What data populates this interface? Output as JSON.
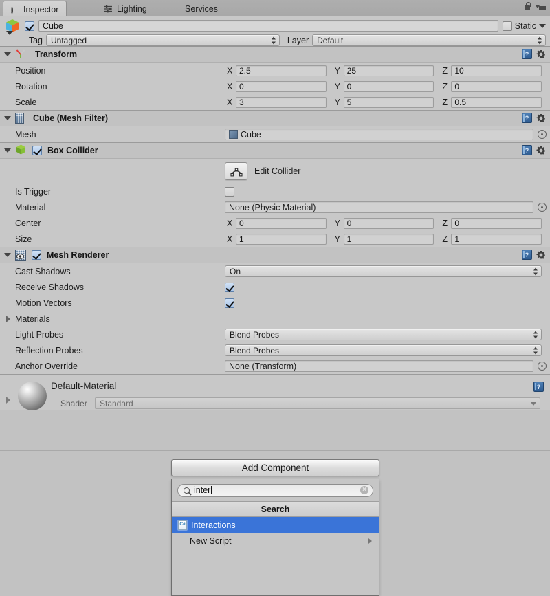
{
  "window": {
    "tabs": [
      {
        "label": "Inspector",
        "icon": "info-icon",
        "active": true
      },
      {
        "label": "Lighting",
        "icon": "lighting-sliders-icon",
        "active": false
      },
      {
        "label": "Services",
        "icon": "none",
        "active": false
      }
    ],
    "lock_icon": "lock-icon",
    "menu_icon": "hamburger-menu-icon"
  },
  "object_header": {
    "icon": "gameobject-cube-icon",
    "enabled": true,
    "name": "Cube",
    "static_label": "Static",
    "static_checked": false,
    "tag_label": "Tag",
    "tag_value": "Untagged",
    "layer_label": "Layer",
    "layer_value": "Default"
  },
  "components": [
    {
      "id": "transform",
      "title": "Transform",
      "icon": "transform-axis-icon",
      "expanded": true,
      "has_checkbox": false,
      "rows": [
        {
          "type": "vector3",
          "label": "Position",
          "axes": [
            "X",
            "Y",
            "Z"
          ],
          "values": [
            "2.5",
            "25",
            "10"
          ]
        },
        {
          "type": "vector3",
          "label": "Rotation",
          "axes": [
            "X",
            "Y",
            "Z"
          ],
          "values": [
            "0",
            "0",
            "0"
          ]
        },
        {
          "type": "vector3",
          "label": "Scale",
          "axes": [
            "X",
            "Y",
            "Z"
          ],
          "values": [
            "3",
            "5",
            "0.5"
          ]
        }
      ]
    },
    {
      "id": "mesh-filter",
      "title": "Cube (Mesh Filter)",
      "icon": "mesh-filter-icon",
      "expanded": true,
      "has_checkbox": false,
      "rows": [
        {
          "type": "object",
          "label": "Mesh",
          "value": "Cube",
          "value_icon": "mesh-icon"
        }
      ]
    },
    {
      "id": "box-collider",
      "title": "Box Collider",
      "icon": "box-collider-icon",
      "expanded": true,
      "has_checkbox": true,
      "checked": true,
      "rows": [
        {
          "type": "button",
          "label": "",
          "button_label": "Edit Collider",
          "button_icon": "edit-collider-icon"
        },
        {
          "type": "checkbox",
          "label": "Is Trigger",
          "checked": false
        },
        {
          "type": "object",
          "label": "Material",
          "value": "None (Physic Material)"
        },
        {
          "type": "vector3",
          "label": "Center",
          "axes": [
            "X",
            "Y",
            "Z"
          ],
          "values": [
            "0",
            "0",
            "0"
          ]
        },
        {
          "type": "vector3",
          "label": "Size",
          "axes": [
            "X",
            "Y",
            "Z"
          ],
          "values": [
            "1",
            "1",
            "1"
          ]
        }
      ]
    },
    {
      "id": "mesh-renderer",
      "title": "Mesh Renderer",
      "icon": "mesh-renderer-icon",
      "expanded": true,
      "has_checkbox": true,
      "checked": true,
      "rows": [
        {
          "type": "popup",
          "label": "Cast Shadows",
          "value": "On"
        },
        {
          "type": "checkbox",
          "label": "Receive Shadows",
          "checked": true
        },
        {
          "type": "checkbox",
          "label": "Motion Vectors",
          "checked": true
        },
        {
          "type": "foldout",
          "label": "Materials",
          "expanded": false
        },
        {
          "type": "popup",
          "label": "Light Probes",
          "value": "Blend Probes"
        },
        {
          "type": "popup",
          "label": "Reflection Probes",
          "value": "Blend Probes"
        },
        {
          "type": "object",
          "label": "Anchor Override",
          "value": "None (Transform)"
        }
      ]
    }
  ],
  "material": {
    "name": "Default-Material",
    "shader_label": "Shader",
    "shader_value": "Standard",
    "preview_icon": "material-sphere-preview",
    "expanded": false
  },
  "add_component": {
    "button_label": "Add Component",
    "search_value": "inter",
    "search_icon": "search-icon",
    "clear_icon": "clear-icon",
    "results_header": "Search",
    "items": [
      {
        "label": "Interactions",
        "icon": "csharp-script-icon",
        "selected": true,
        "submenu": false
      },
      {
        "label": "New Script",
        "icon": "none",
        "selected": false,
        "submenu": true
      }
    ]
  },
  "colors": {
    "panel_bg": "#c2c2c2",
    "component_bg": "#c8c8c8",
    "selection_blue": "#3a74d8",
    "field_bg": "#d1d1d1",
    "checkbox_blue": "#a9c6ea"
  }
}
